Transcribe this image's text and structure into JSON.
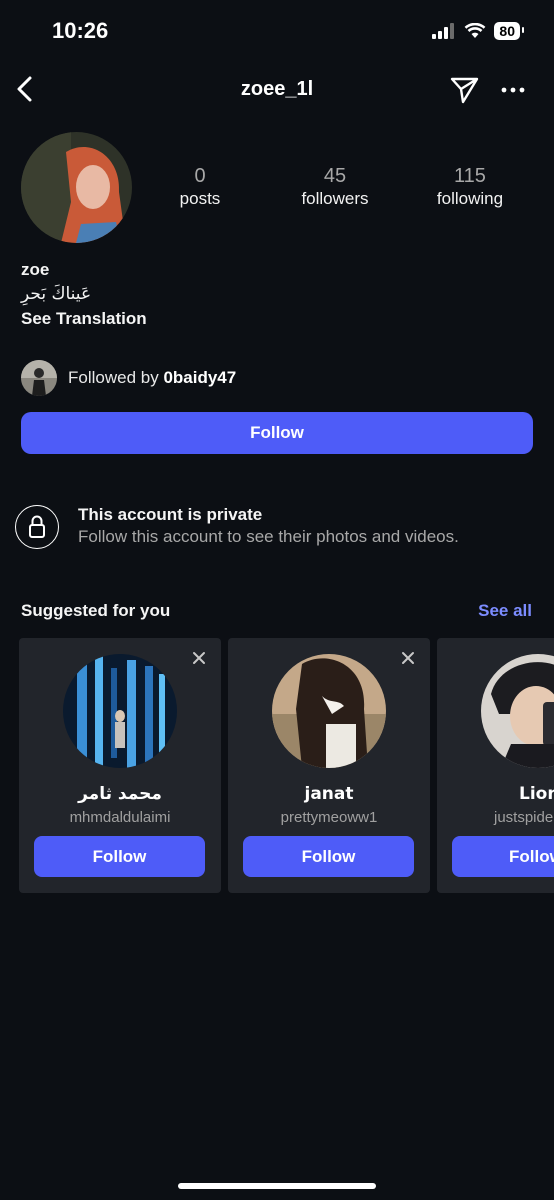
{
  "status_bar": {
    "time": "10:26",
    "battery": "80"
  },
  "header": {
    "username": "zoee_1l"
  },
  "stats": [
    {
      "value": "0",
      "label": "posts"
    },
    {
      "value": "45",
      "label": "followers"
    },
    {
      "value": "115",
      "label": "following"
    }
  ],
  "profile": {
    "name": "zoe",
    "bio": "عَيناكَ بَحرِ",
    "see_translation": "See Translation",
    "followed_by_prefix": "Followed by ",
    "followed_by_user": "0baidy47",
    "follow_label": "Follow"
  },
  "private": {
    "title": "This account is private",
    "subtitle": "Follow this account to see their photos and videos."
  },
  "suggested": {
    "title": "Suggested for you",
    "see_all": "See all",
    "cards": [
      {
        "name": "محمد ثامر",
        "handle": "mhmdaldulaimi",
        "follow": "Follow"
      },
      {
        "name": "janat",
        "handle": "prettymeoww1",
        "follow": "Follow"
      },
      {
        "name": "Lion",
        "handle": "justspide",
        "follow": "Follow"
      }
    ]
  },
  "colors": {
    "accent": "#4e5cf8",
    "link": "#7c8cff",
    "background": "#0c0f14",
    "card": "#22252b"
  }
}
